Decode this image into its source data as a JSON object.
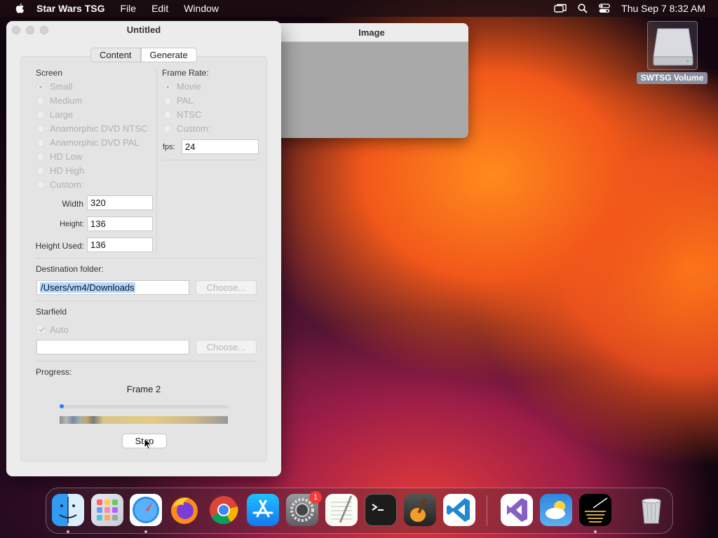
{
  "menubar": {
    "app_name": "Star Wars TSG",
    "items": [
      "File",
      "Edit",
      "Window"
    ],
    "datetime": "Thu Sep 7  8:32 AM"
  },
  "image_window": {
    "title": "Image"
  },
  "main_window": {
    "title": "Untitled",
    "tabs": [
      {
        "label": "Content",
        "active": false
      },
      {
        "label": "Generate",
        "active": true
      }
    ],
    "screen": {
      "heading": "Screen",
      "options": [
        "Small",
        "Medium",
        "Large",
        "Anamorphic DVD NTSC",
        "Anamorphic DVD PAL",
        "HD Low",
        "HD High",
        "Custom:"
      ],
      "selected": "Small",
      "width_label": "Width",
      "width_value": "320",
      "height_label": "Height:",
      "height_value": "136",
      "height_used_label": "Height Used:",
      "height_used_value": "136"
    },
    "frame_rate": {
      "heading": "Frame Rate:",
      "options": [
        "Movie",
        "PAL",
        "NTSC",
        "Custom:"
      ],
      "selected": "Movie",
      "fps_label": "fps:",
      "fps_value": "24"
    },
    "destination": {
      "heading": "Destination folder:",
      "path": "/Users/vm4/Downloads",
      "choose_label": "Choose..."
    },
    "starfield": {
      "heading": "Starfield",
      "auto_label": "Auto",
      "auto_checked": true,
      "path": "",
      "choose_label": "Choose..."
    },
    "progress": {
      "heading": "Progress:",
      "status": "Frame 2",
      "fraction": 0.0,
      "stop_label": "Stop"
    }
  },
  "desktop": {
    "drive_label": "SWTSG Volume"
  },
  "dock": {
    "apps": [
      {
        "icon": "finder-icon",
        "running": true
      },
      {
        "icon": "launchpad-icon",
        "running": false
      },
      {
        "icon": "safari-icon",
        "running": true
      },
      {
        "icon": "firefox-icon",
        "running": false
      },
      {
        "icon": "chrome-icon",
        "running": false
      },
      {
        "icon": "app-store-icon",
        "running": false
      },
      {
        "icon": "system-settings-icon",
        "running": false,
        "badge": "1"
      },
      {
        "icon": "textedit-icon",
        "running": false
      },
      {
        "icon": "terminal-icon",
        "running": false
      },
      {
        "icon": "garageband-icon",
        "running": false
      },
      {
        "icon": "vscode-icon",
        "running": false
      },
      {
        "icon": "visual-studio-icon",
        "running": false
      },
      {
        "icon": "weather-icon",
        "running": false
      },
      {
        "icon": "star-wars-tsg-icon",
        "running": true
      },
      {
        "icon": "trash-icon",
        "running": false
      }
    ]
  }
}
